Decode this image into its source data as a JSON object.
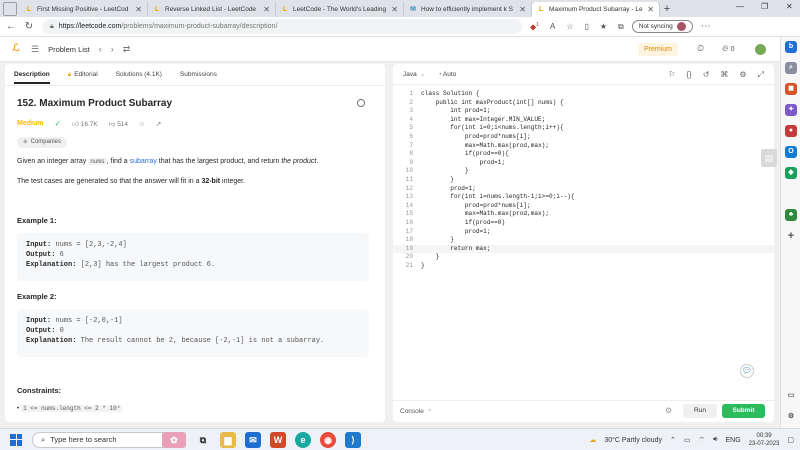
{
  "browser": {
    "tabs": [
      {
        "title": "First Missing Positive - LeetCod",
        "favicon": "L",
        "active": false
      },
      {
        "title": "Reverse Linked List - LeetCode",
        "favicon": "L",
        "active": false
      },
      {
        "title": "LeetCode - The World's Leading",
        "favicon": "L",
        "active": false
      },
      {
        "title": "How to efficiently implement k S",
        "favicon": "✉",
        "active": false
      },
      {
        "title": "Maximum Product Subarray - Le",
        "favicon": "L",
        "active": true
      }
    ],
    "url_domain": "https://leetcode.com",
    "url_path": "/problems/maximum-product-subarray/description/",
    "sync_label": "Not syncing",
    "badge_count": "1"
  },
  "lc_header": {
    "problem_list": "Problem List",
    "premium": "Premium",
    "count": "0"
  },
  "problem": {
    "tabs": [
      "Description",
      "Editorial",
      "Solutions (4.1K)",
      "Submissions"
    ],
    "title": "152. Maximum Product Subarray",
    "difficulty": "Medium",
    "likes": "16.7K",
    "dislikes": "514",
    "companies": "Companies",
    "desc_1a": "Given an integer array ",
    "desc_1code": "nums",
    "desc_1b": ", find a ",
    "desc_1link": "subarray",
    "desc_1c": " that has the largest product, and return ",
    "desc_1em": "the product",
    "desc_1d": ".",
    "desc_2a": "The test cases are generated so that the answer will fit in a ",
    "desc_2b": "32-bit",
    "desc_2c": " integer.",
    "example1": {
      "heading": "Example 1:",
      "input_k": "Input:",
      "input_v": " nums = [2,3,-2,4]",
      "output_k": "Output:",
      "output_v": " 6",
      "expl_k": "Explanation:",
      "expl_v": " [2,3] has the largest product 6."
    },
    "example2": {
      "heading": "Example 2:",
      "input_k": "Input:",
      "input_v": " nums = [-2,0,-1]",
      "output_k": "Output:",
      "output_v": " 0",
      "expl_k": "Explanation:",
      "expl_v": " The result cannot be 2, because [-2,-1] is not a subarray."
    },
    "constraints_heading": "Constraints:",
    "constraint_1": "1 <= nums.length <= 2 * 10⁴"
  },
  "editor": {
    "language": "Java",
    "mode": "Auto",
    "lines": [
      "class Solution {",
      "    public int maxProduct(int[] nums) {",
      "        int prod=1;",
      "        int max=Integer.MIN_VALUE;",
      "        for(int i=0;i<nums.length;i++){",
      "            prod=prod*nums[i];",
      "            max=Math.max(prod,max);",
      "            if(prod==0){",
      "                prod=1;",
      "            }",
      "        }",
      "        prod=1;",
      "        for(int i=nums.length-1;i>=0;i--){",
      "            prod=prod*nums[i];",
      "            max=Math.max(prod,max);",
      "            if(prod==0)",
      "            prod=1;",
      "        }",
      "        return max;",
      "    }",
      "}"
    ],
    "highlighted_line": 19,
    "console": "Console",
    "run": "Run",
    "submit": "Submit"
  },
  "taskbar": {
    "search_placeholder": "Type here to search",
    "weather": "30°C  Partly cloudy",
    "lang": "ENG",
    "time": "00:39",
    "date": "23-07-2023"
  },
  "colors": {
    "accent_orange": "#f89f1b",
    "medium": "#ffb800",
    "submit_green": "#2cbb5d",
    "link_blue": "#2a6fd6"
  }
}
